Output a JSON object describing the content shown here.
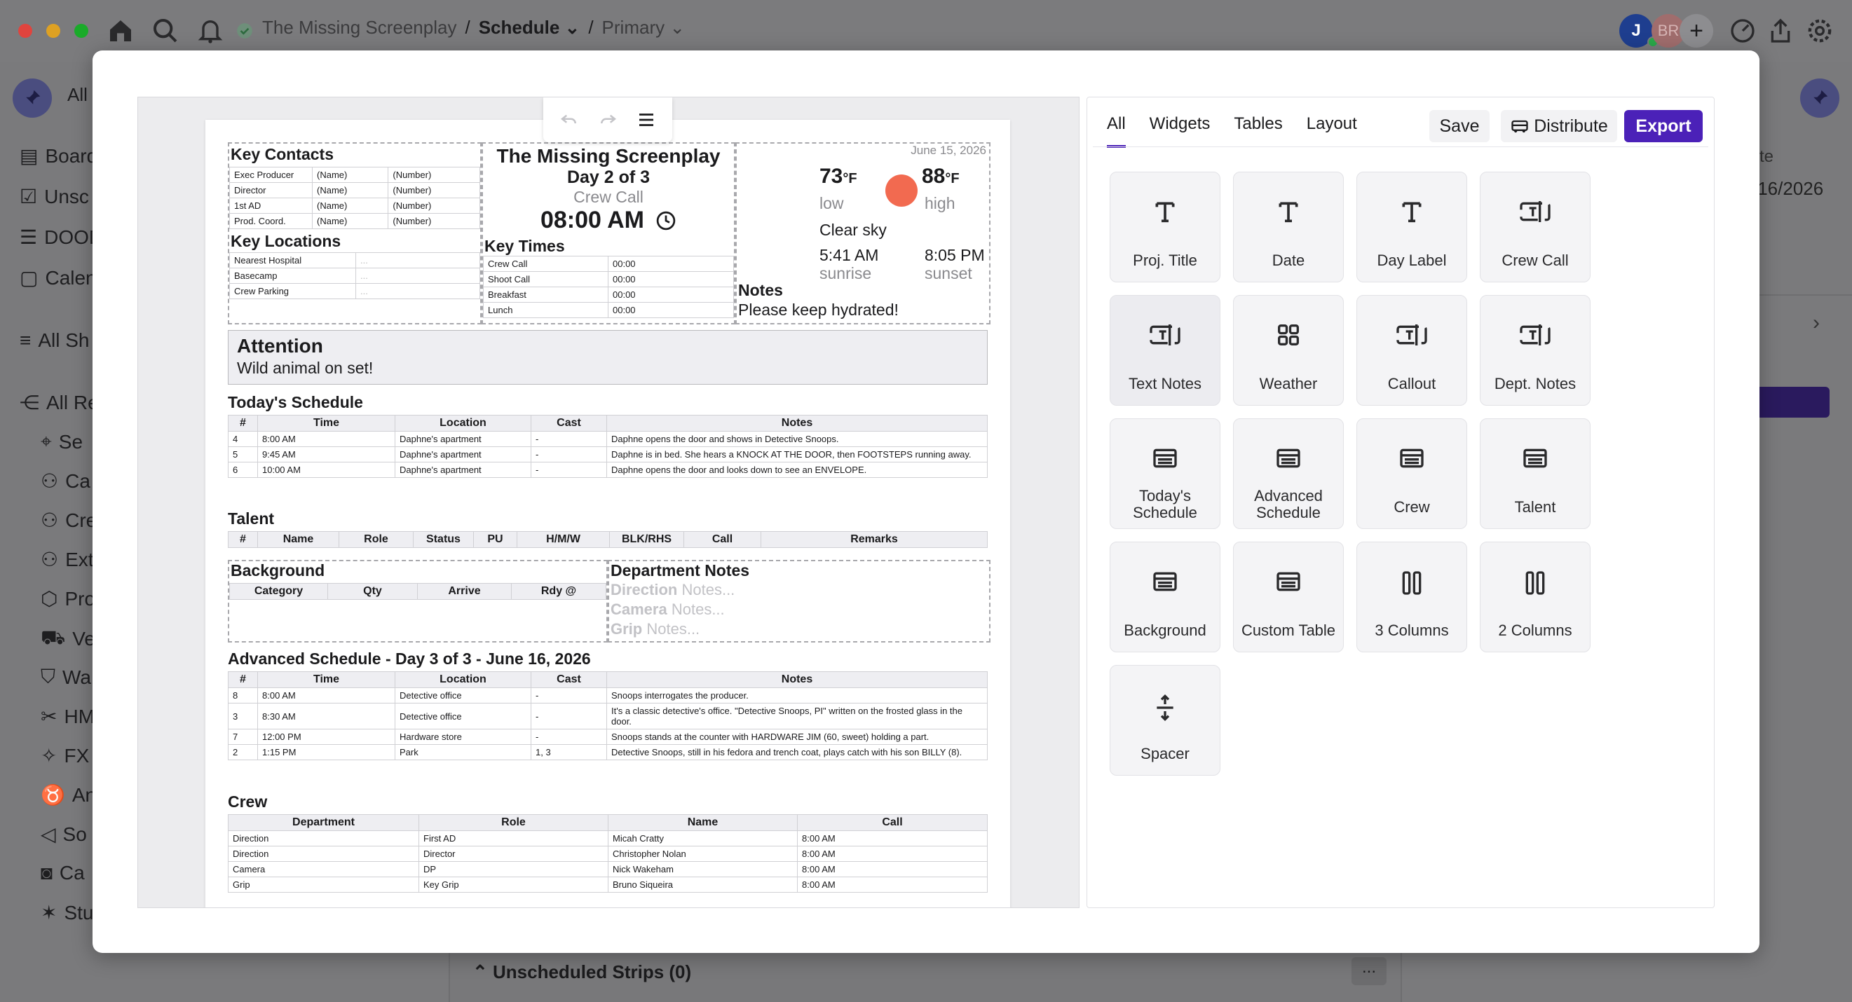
{
  "app": {
    "project": "The Missing Screenplay",
    "separator": "/",
    "page": "Schedule",
    "view": "Primary",
    "avatar_j": "J",
    "avatar_br": "BR"
  },
  "sidebar": {
    "all_tab": "All",
    "items": [
      {
        "label": "Board"
      },
      {
        "label": "Unsc"
      },
      {
        "label": "DOOD"
      },
      {
        "label": "Calen"
      },
      {
        "label": "All Sh"
      },
      {
        "label": "All Re"
      },
      {
        "label": "Se"
      },
      {
        "label": "Ca"
      },
      {
        "label": "Cre"
      },
      {
        "label": "Ext"
      },
      {
        "label": "Pro"
      },
      {
        "label": "Ve"
      },
      {
        "label": "Wa"
      },
      {
        "label": "HM"
      },
      {
        "label": "FX"
      },
      {
        "label": "An"
      },
      {
        "label": "So"
      },
      {
        "label": "Ca"
      },
      {
        "label": "Stu"
      }
    ]
  },
  "background": {
    "right_date": "/16/2026",
    "right_te": "te",
    "unscheduled": "Unscheduled Strips (0)",
    "more": "..."
  },
  "sheet": {
    "key_contacts": {
      "title": "Key Contacts",
      "rows": [
        [
          "Exec Producer",
          "(Name)",
          "(Number)"
        ],
        [
          "Director",
          "(Name)",
          "(Number)"
        ],
        [
          "1st AD",
          "(Name)",
          "(Number)"
        ],
        [
          "Prod. Coord.",
          "(Name)",
          "(Number)"
        ]
      ]
    },
    "key_locations": {
      "title": "Key Locations",
      "rows": [
        [
          "Nearest Hospital",
          "..."
        ],
        [
          "Basecamp",
          "..."
        ],
        [
          "Crew Parking",
          "..."
        ]
      ]
    },
    "title": "The Missing Screenplay",
    "day": "Day 2 of 3",
    "crew_call_label": "Crew Call",
    "crew_call_time": "08:00 AM",
    "key_times": {
      "title": "Key Times",
      "rows": [
        [
          "Crew Call",
          "00:00"
        ],
        [
          "Shoot Call",
          "00:00"
        ],
        [
          "Breakfast",
          "00:00"
        ],
        [
          "Lunch",
          "00:00"
        ]
      ]
    },
    "date": "June 15, 2026",
    "weather": {
      "low": "73",
      "low_unit": "°F",
      "low_label": "low",
      "high": "88",
      "high_unit": "°F",
      "high_label": "high",
      "condition": "Clear sky",
      "sunrise": "5:41 AM",
      "sunrise_label": "sunrise",
      "sunset": "8:05 PM",
      "sunset_label": "sunset",
      "sun_color": "#f26a50"
    },
    "notes": {
      "title": "Notes",
      "text": "Please keep hydrated!"
    },
    "attention": {
      "title": "Attention",
      "text": "Wild animal on set!"
    },
    "todays_schedule": {
      "title": "Today's Schedule",
      "headers": [
        "#",
        "Time",
        "Location",
        "Cast",
        "Notes"
      ],
      "rows": [
        [
          "4",
          "8:00 AM",
          "Daphne's apartment",
          "-",
          "Daphne opens the door and shows in Detective Snoops."
        ],
        [
          "5",
          "9:45 AM",
          "Daphne's apartment",
          "-",
          "Daphne is in bed. She hears a KNOCK AT THE DOOR, then FOOTSTEPS running away."
        ],
        [
          "6",
          "10:00 AM",
          "Daphne's apartment",
          "-",
          "Daphne opens the door and looks down to see an ENVELOPE."
        ]
      ]
    },
    "talent": {
      "title": "Talent",
      "headers": [
        "#",
        "Name",
        "Role",
        "Status",
        "PU",
        "H/M/W",
        "BLK/RHS",
        "Call",
        "Remarks"
      ]
    },
    "background_section": {
      "title": "Background",
      "headers": [
        "Category",
        "Qty",
        "Arrive",
        "Rdy @"
      ]
    },
    "dept_notes": {
      "title": "Department Notes",
      "rows": [
        [
          "Direction",
          "Notes..."
        ],
        [
          "Camera",
          "Notes..."
        ],
        [
          "Grip",
          "Notes..."
        ]
      ]
    },
    "advanced_schedule": {
      "title": "Advanced Schedule - Day 3 of 3 - June 16, 2026",
      "headers": [
        "#",
        "Time",
        "Location",
        "Cast",
        "Notes"
      ],
      "rows": [
        [
          "8",
          "8:00 AM",
          "Detective office",
          "-",
          "Snoops interrogates the producer."
        ],
        [
          "3",
          "8:30 AM",
          "Detective office",
          "-",
          "It's a classic detective's office. \"Detective Snoops, PI\" written on the frosted glass in the door."
        ],
        [
          "7",
          "12:00 PM",
          "Hardware store",
          "-",
          "Snoops stands at the counter with HARDWARE JIM (60, sweet) holding a part."
        ],
        [
          "2",
          "1:15 PM",
          "Park",
          "1, 3",
          "Detective Snoops, still in his fedora and trench coat, plays catch with his son BILLY (8)."
        ]
      ]
    },
    "crew": {
      "title": "Crew",
      "headers": [
        "Department",
        "Role",
        "Name",
        "Call"
      ],
      "rows": [
        [
          "Direction",
          "First AD",
          "Micah Cratty",
          "8:00 AM"
        ],
        [
          "Direction",
          "Director",
          "Christopher Nolan",
          "8:00 AM"
        ],
        [
          "Camera",
          "DP",
          "Nick Wakeham",
          "8:00 AM"
        ],
        [
          "Grip",
          "Key Grip",
          "Bruno Siqueira",
          "8:00 AM"
        ]
      ]
    }
  },
  "panel": {
    "tabs": [
      "All",
      "Widgets",
      "Tables",
      "Layout"
    ],
    "save": "Save",
    "distribute": "Distribute",
    "export": "Export",
    "accent": "#4b21b8",
    "tiles": [
      {
        "label": "Proj. Title",
        "icon": "text-icon"
      },
      {
        "label": "Date",
        "icon": "text-icon"
      },
      {
        "label": "Day Label",
        "icon": "text-icon"
      },
      {
        "label": "Crew Call",
        "icon": "text-box-icon"
      },
      {
        "label": "Text Notes",
        "icon": "text-box-icon"
      },
      {
        "label": "Weather",
        "icon": "grid-icon"
      },
      {
        "label": "Callout",
        "icon": "text-box-icon"
      },
      {
        "label": "Dept. Notes",
        "icon": "text-box-icon"
      },
      {
        "label": "Today's Schedule",
        "icon": "table-icon"
      },
      {
        "label": "Advanced Schedule",
        "icon": "table-icon"
      },
      {
        "label": "Crew",
        "icon": "table-icon"
      },
      {
        "label": "Talent",
        "icon": "table-icon"
      },
      {
        "label": "Background",
        "icon": "table-icon"
      },
      {
        "label": "Custom Table",
        "icon": "table-icon"
      },
      {
        "label": "3 Columns",
        "icon": "columns-icon"
      },
      {
        "label": "2 Columns",
        "icon": "columns-icon"
      },
      {
        "label": "Spacer",
        "icon": "spacer-icon"
      }
    ]
  }
}
